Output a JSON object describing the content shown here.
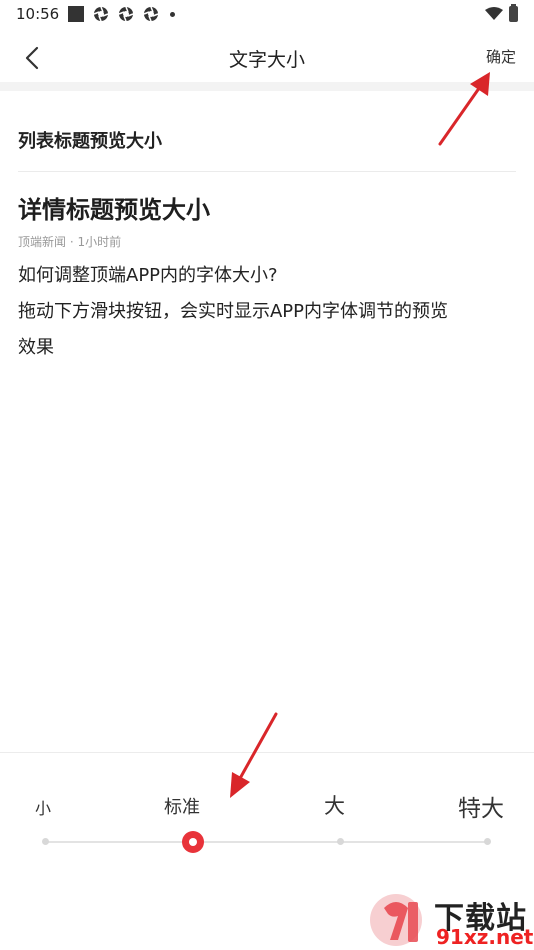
{
  "status_bar": {
    "time": "10:56"
  },
  "header": {
    "title": "文字大小",
    "confirm_label": "确定"
  },
  "preview": {
    "list_title": "列表标题预览大小",
    "detail_title": "详情标题预览大小",
    "meta": "顶端新闻 · 1小时前",
    "body_lines": [
      "如何调整顶端APP内的字体大小?",
      "拖动下方滑块按钮，会实时显示APP内字体调节的预览",
      "效果"
    ]
  },
  "font_size_slider": {
    "options": [
      "小",
      "标准",
      "大",
      "特大"
    ],
    "selected_index": 1,
    "accent_color": "#e8333a"
  },
  "watermark": {
    "site_name": "下载站",
    "url": "91xz.net"
  }
}
